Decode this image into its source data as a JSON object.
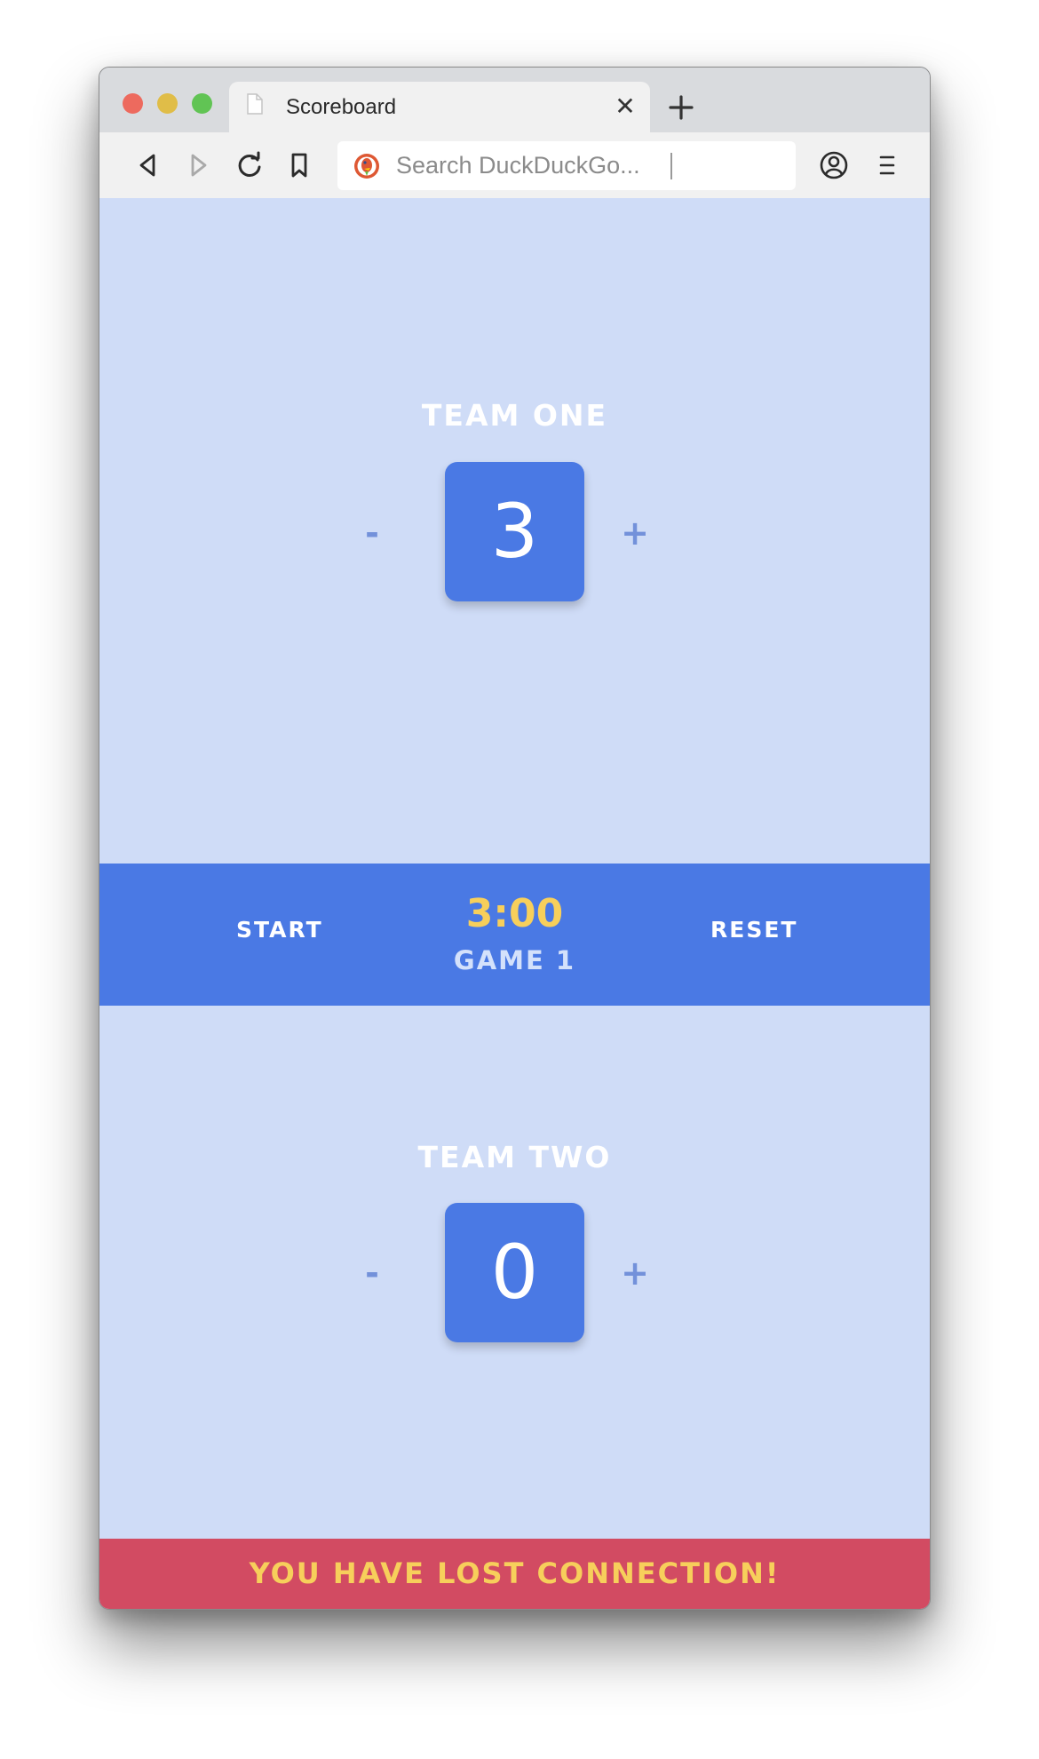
{
  "browser": {
    "tab_title": "Scoreboard",
    "tab_close_glyph": "✕",
    "url_placeholder": "Search DuckDuckGo..."
  },
  "teams": [
    {
      "name": "TEAM ONE",
      "score": "3",
      "minus": "-",
      "plus": "+"
    },
    {
      "name": "TEAM TWO",
      "score": "0",
      "minus": "-",
      "plus": "+"
    }
  ],
  "timer": {
    "start_label": "START",
    "time": "3:00",
    "game_label": "GAME 1",
    "reset_label": "RESET"
  },
  "alert": {
    "message": "YOU HAVE LOST CONNECTION!"
  },
  "colors": {
    "background": "#cfdcf7",
    "accent": "#4a79e4",
    "timer_text": "#f7cf5b",
    "alert_bg": "#d24b62",
    "adjust_button": "#7391da"
  },
  "icons": {
    "traffic_lights": [
      "close-dot",
      "minimize-dot",
      "zoom-dot"
    ],
    "toolbar": [
      "back-icon",
      "forward-icon",
      "reload-icon",
      "bookmark-icon",
      "duckduckgo-icon",
      "account-icon",
      "menu-icon"
    ]
  }
}
